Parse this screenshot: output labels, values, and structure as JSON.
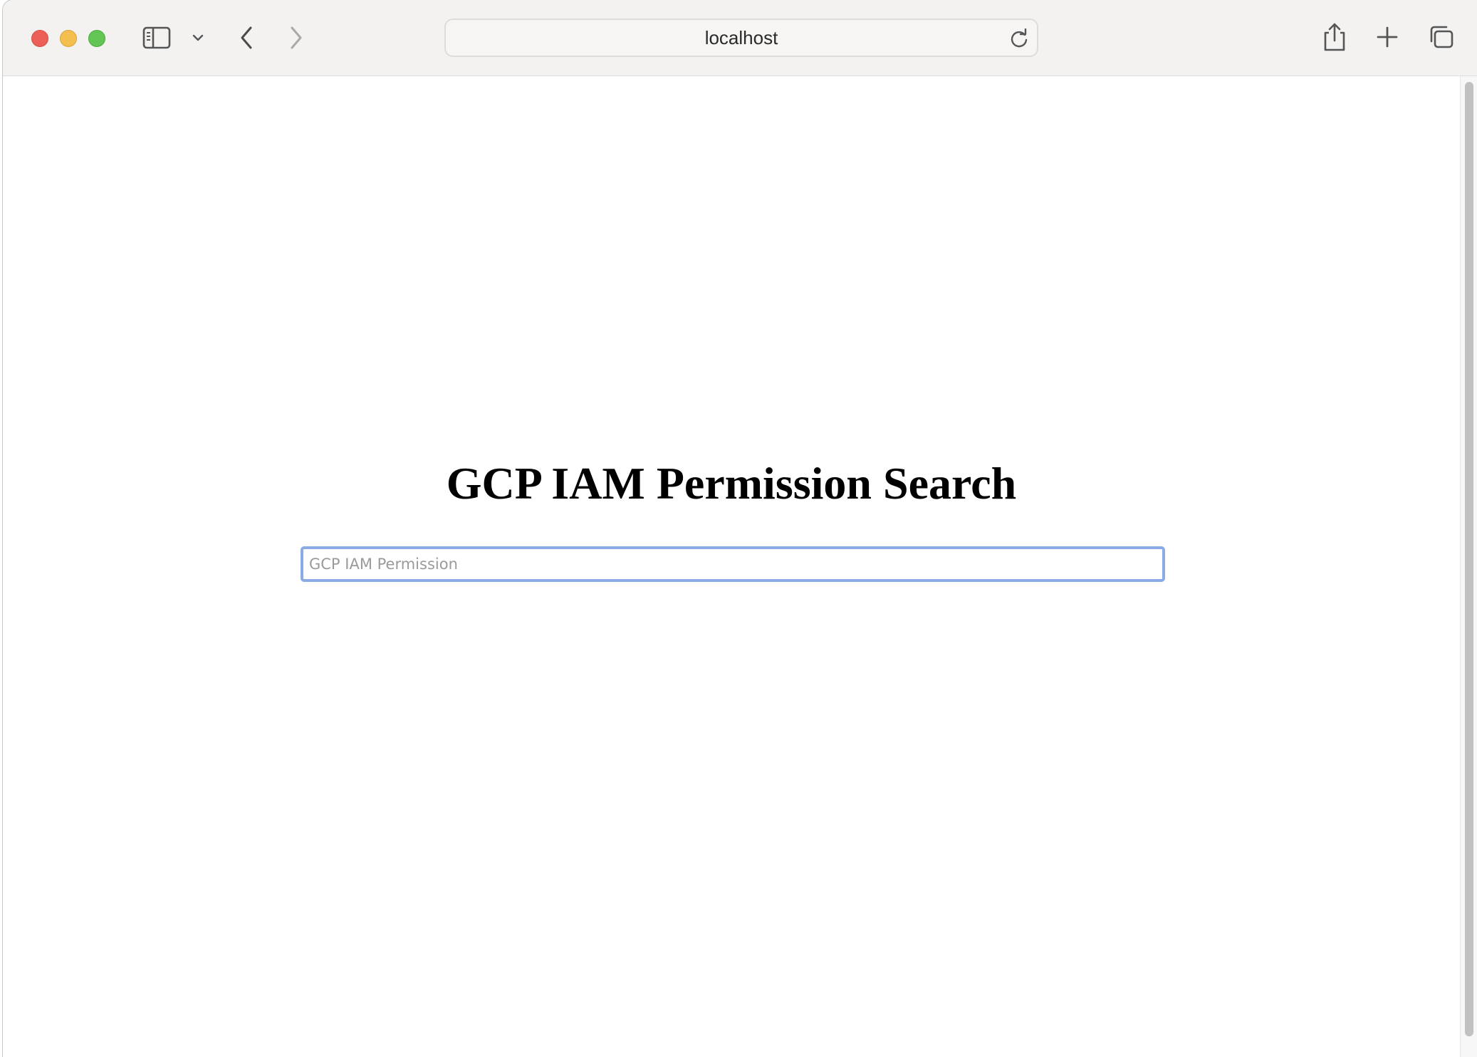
{
  "browser": {
    "address_text": "localhost",
    "icons": {
      "sidebar": "sidebar-icon",
      "tab_group_menu": "chevron-down-icon",
      "back": "chevron-left-icon",
      "forward": "chevron-right-icon",
      "reload": "reload-icon",
      "share": "share-icon",
      "new_tab": "plus-icon",
      "tab_overview": "tab-overview-icon"
    },
    "colors": {
      "close": "#ec5f57",
      "minimize": "#f4bf4f",
      "zoom": "#62c554",
      "focus_ring": "#8aabe6"
    }
  },
  "page": {
    "title": "GCP IAM Permission Search",
    "search": {
      "placeholder": "GCP IAM Permission",
      "value": ""
    }
  }
}
